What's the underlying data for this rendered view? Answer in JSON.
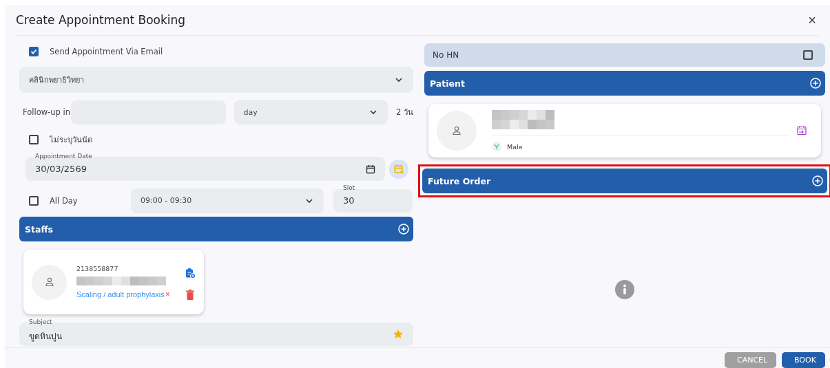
{
  "window": {
    "title": "Create Appointment Booking",
    "close": "×"
  },
  "send_email": {
    "label": "Send Appointment Via Email",
    "checked": true
  },
  "clinic": {
    "value": "คลินิกพยาธิวิทยา"
  },
  "follow_up": {
    "label": "Follow-up in",
    "unit": "day",
    "summary": "2 วัน"
  },
  "no_date": {
    "label": "ไม่ระบุวันนัด",
    "checked": false
  },
  "appointment_date": {
    "label": "Appointment Date",
    "value": "30/03/2569"
  },
  "all_day": {
    "label": "All Day",
    "checked": false
  },
  "time": {
    "value": "09:00 - 09:30"
  },
  "slot": {
    "label": "Slot",
    "value": "30"
  },
  "staffs": {
    "title": "Staffs",
    "items": [
      {
        "id": "2138558877",
        "procedure": "Scaling / adult prophylaxis",
        "remove": "×"
      }
    ]
  },
  "subject": {
    "label": "Subject",
    "value": "ขูดหินปูน",
    "starred": true
  },
  "no_hn": {
    "label": "No HN",
    "checked": false
  },
  "patient": {
    "title": "Patient",
    "gender": "Male"
  },
  "future_order": {
    "title": "Future Order",
    "highlighted": true
  },
  "buttons": [
    {
      "label": "CANCEL",
      "kind": "secondary"
    },
    {
      "label": "BOOK",
      "kind": "primary"
    }
  ]
}
